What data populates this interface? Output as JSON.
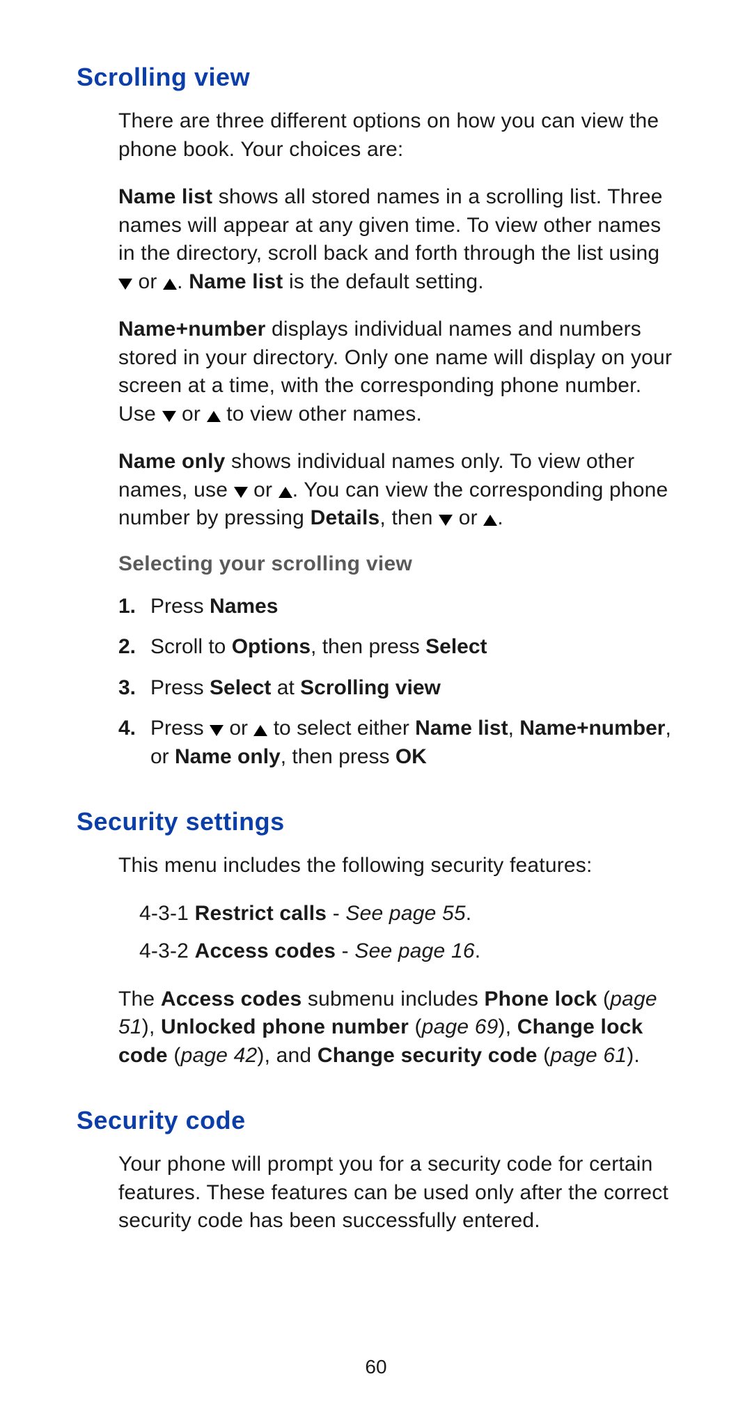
{
  "page_number": "60",
  "sections": {
    "scrolling_view": {
      "heading": "Scrolling view",
      "intro": "There are three different options on how you can view the phone book. Your choices are:",
      "name_list": {
        "label": "Name list",
        "t1": " shows all stored names in a scrolling list. Three names will appear at any given time. To view other names in the directory, scroll back and forth through the list using ",
        "or": " or ",
        "t2": ". ",
        "label2": "Name list",
        "t3": " is the default setting."
      },
      "name_number": {
        "label": "Name+number",
        "t1": " displays individual names and numbers stored in your directory. Only one name will display on your screen at a time, with the corresponding phone number. Use ",
        "or": " or ",
        "t2": " to view other names."
      },
      "name_only": {
        "label": "Name only",
        "t1": " shows individual names only. To view other names, use ",
        "or1": " or ",
        "t2": ". You can view the corresponding phone number by pressing ",
        "details": "Details",
        "t3": ", then ",
        "or2": " or ",
        "t4": "."
      },
      "sub_heading": "Selecting your scrolling view",
      "steps": {
        "s1": {
          "pre": "Press ",
          "b1": "Names"
        },
        "s2": {
          "pre": "Scroll to ",
          "b1": "Options",
          "mid": ", then press ",
          "b2": "Select"
        },
        "s3": {
          "pre": "Press ",
          "b1": "Select",
          "mid": " at ",
          "b2": "Scrolling view"
        },
        "s4": {
          "pre": "Press ",
          "or": " or ",
          "mid": " to select either ",
          "b1": "Name list",
          "c1": ", ",
          "b2": "Name+number",
          "c2": ", or ",
          "b3": "Name only",
          "c3": ", then press ",
          "b4": "OK"
        }
      }
    },
    "security_settings": {
      "heading": "Security settings",
      "intro": "This menu includes the following security features:",
      "item1": {
        "code": "4-3-1 ",
        "label": "Restrict calls",
        "sep": " - ",
        "ref": "See page 55",
        "dot": "."
      },
      "item2": {
        "code": "4-3-2 ",
        "label": "Access codes",
        "sep": " - ",
        "ref": "See page 16",
        "dot": "."
      },
      "access_para": {
        "t1": "The ",
        "b1": "Access codes",
        "t2": " submenu includes ",
        "b2": "Phone lock",
        "t3": " (",
        "i1": "page 51",
        "t4": "), ",
        "b3": "Unlocked phone number",
        "t5": " (",
        "i2": "page 69",
        "t6": "), ",
        "b4": "Change lock code",
        "t7": " (",
        "i3": "page 42",
        "t8": "), and ",
        "b5": "Change security code",
        "t9": " (",
        "i4": "page 61",
        "t10": ")."
      }
    },
    "security_code": {
      "heading": "Security code",
      "para": "Your phone will prompt you for a security code for cer­tain features. These features can be used only after the correct security code has been successfully entered."
    }
  }
}
